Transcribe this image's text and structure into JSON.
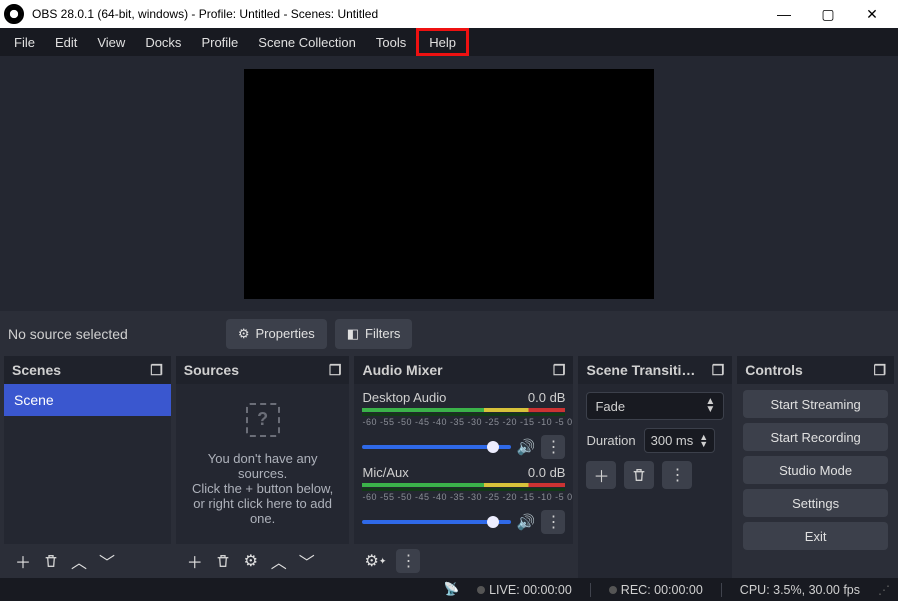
{
  "titlebar": {
    "title": "OBS 28.0.1 (64-bit, windows) - Profile: Untitled - Scenes: Untitled"
  },
  "menu": {
    "file": "File",
    "edit": "Edit",
    "view": "View",
    "docks": "Docks",
    "profile": "Profile",
    "scene_collection": "Scene Collection",
    "tools": "Tools",
    "help": "Help"
  },
  "srcrow": {
    "no_source": "No source selected",
    "properties": "Properties",
    "filters": "Filters"
  },
  "scenes": {
    "title": "Scenes",
    "selected": "Scene"
  },
  "sources": {
    "title": "Sources",
    "hint1": "You don't have any sources.",
    "hint2": "Click the + button below,",
    "hint3": "or right click here to add one."
  },
  "mixer": {
    "title": "Audio Mixer",
    "ch1_name": "Desktop Audio",
    "ch1_db": "0.0 dB",
    "ch2_name": "Mic/Aux",
    "ch2_db": "0.0 dB",
    "ticks": "-60 -55 -50 -45 -40 -35 -30 -25 -20 -15 -10 -5  0"
  },
  "trans": {
    "title": "Scene Transiti…",
    "fade": "Fade",
    "duration_label": "Duration",
    "duration_value": "300 ms"
  },
  "controls": {
    "title": "Controls",
    "start_streaming": "Start Streaming",
    "start_recording": "Start Recording",
    "studio_mode": "Studio Mode",
    "settings": "Settings",
    "exit": "Exit"
  },
  "status": {
    "live": "LIVE: 00:00:00",
    "rec": "REC: 00:00:00",
    "cpu": "CPU: 3.5%, 30.00 fps"
  }
}
